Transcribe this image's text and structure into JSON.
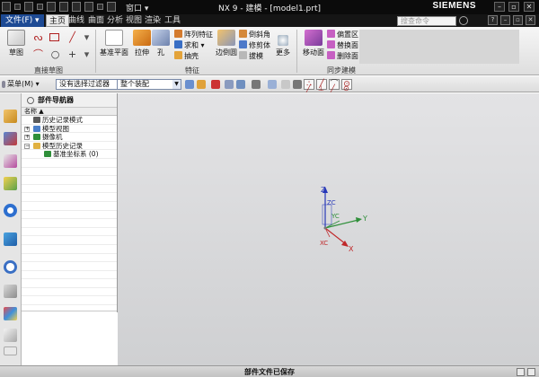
{
  "titlebar": {
    "window_menu": "窗口 ▾",
    "title": "NX 9 - 建模 - [model1.prt]",
    "brand": "SIEMENS",
    "minimize": "–",
    "restore": "▫",
    "close": "✕"
  },
  "menubar": {
    "file_label": "文件(F) ▾",
    "tabs": [
      "主页",
      "曲线",
      "曲面",
      "分析",
      "视图",
      "渲染",
      "工具"
    ],
    "search_placeholder": "搜查命令"
  },
  "ribbon": {
    "sketch_label": "草图",
    "direct_sketch_group": "直接草图",
    "datum_plane_label": "基准平面",
    "extrude_label": "拉伸",
    "hole_label": "孔",
    "pattern_feature_label": "阵列特征",
    "unite_label": "求和 ▾",
    "shell_label": "抽壳",
    "edge_blend_label": "边倒圆",
    "chamfer_label": "倒斜角",
    "trim_body_label": "修剪体",
    "draft_label": "拔模",
    "more_label": "更多",
    "feature_group": "特征",
    "move_face_label": "移动面",
    "offset_region_label": "偏置区",
    "replace_face_label": "替换面",
    "delete_face_label": "删除面",
    "sync_group": "同步建模"
  },
  "selection_bar": {
    "menu_label": "菜单(M) ▾",
    "filter_value": "没有选择过滤器",
    "scope_value": "整个装配"
  },
  "navigator": {
    "title": "部件导航器",
    "column_name": "名称 ▲",
    "items": [
      {
        "label": "历史记录模式",
        "level": 0,
        "expand": ""
      },
      {
        "label": "模型视图",
        "level": 0,
        "expand": "+"
      },
      {
        "label": "摄像机",
        "level": 0,
        "expand": "+"
      },
      {
        "label": "模型历史记录",
        "level": 0,
        "expand": "−"
      },
      {
        "label": "基准坐标系 (0)",
        "level": 1,
        "expand": ""
      }
    ]
  },
  "graphics": {
    "axis_z": "Z",
    "axis_y": "Y",
    "axis_x": "X",
    "axis_zc": "ZC",
    "axis_yc": "YC",
    "axis_xc": "XC"
  },
  "status": {
    "message": "部件文件已保存"
  },
  "colors": {
    "file_button": "#1d4a94",
    "graphics_bg": "#dcdcde",
    "axis_red": "#c0282a",
    "axis_green": "#2f8f3a",
    "axis_blue": "#2536b8"
  }
}
